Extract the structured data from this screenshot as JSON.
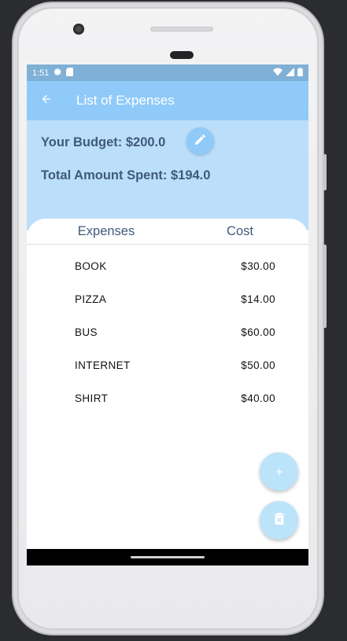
{
  "status_bar": {
    "time": "1:51",
    "icons": [
      "settings-icon",
      "sim-card-icon",
      "wifi-icon",
      "signal-icon",
      "battery-icon"
    ]
  },
  "app_bar": {
    "title": "List of Expenses",
    "back_icon": "arrow-back-icon"
  },
  "summary": {
    "budget": "Your Budget: $200.0",
    "spent": "Total Amount Spent: $194.0",
    "edit_icon": "pencil-icon"
  },
  "table": {
    "headers": [
      "Expenses",
      "Cost"
    ],
    "rows": [
      {
        "name": "BOOK",
        "cost": "$30.00"
      },
      {
        "name": "PIZZA",
        "cost": "$14.00"
      },
      {
        "name": "BUS",
        "cost": "$60.00"
      },
      {
        "name": "INTERNET",
        "cost": "$50.00"
      },
      {
        "name": "SHIRT",
        "cost": "$40.00"
      }
    ]
  },
  "fabs": {
    "add_icon": "plus-icon",
    "delete_icon": "delete-box-icon"
  },
  "colors": {
    "app_bar": "#90caf9",
    "header_area": "#bbdefb",
    "text_primary": "#3f5a7a",
    "status_bar": "#7fb0d6"
  }
}
